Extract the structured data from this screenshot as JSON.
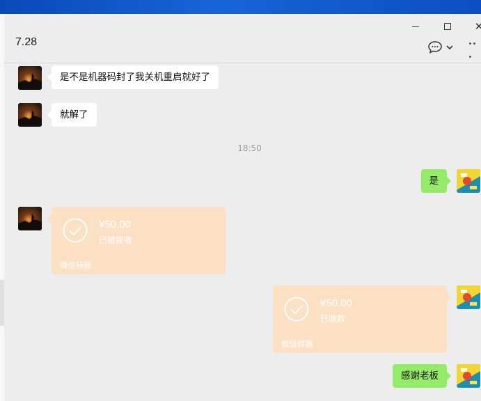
{
  "window": {
    "title": "7.28",
    "minimize_label": "",
    "maximize_label": "",
    "close_label": "✕"
  },
  "messages": [
    {
      "side": "in",
      "type": "text",
      "text": "是不是机器码封了我关机重启就好了"
    },
    {
      "side": "in",
      "type": "text",
      "text": "就解了"
    },
    {
      "type": "time",
      "text": "18:50"
    },
    {
      "side": "out",
      "type": "text",
      "text": "是"
    },
    {
      "side": "in",
      "type": "transfer",
      "amount": "¥50.00",
      "status": "已被接收",
      "footer": "微信转账"
    },
    {
      "side": "out",
      "type": "transfer",
      "amount": "¥50.00",
      "status": "已收款",
      "footer": "微信转账"
    },
    {
      "side": "out",
      "type": "text",
      "text": "感谢老板"
    }
  ],
  "colors": {
    "incoming_bubble": "#ffffff",
    "outgoing_bubble": "#95ec69",
    "transfer_card": "#fce0c4",
    "background": "#ededed",
    "title_bar": "#1764d8"
  },
  "icons": {
    "chat_info": "chat-bubble-icon",
    "more": "more-dots-icon",
    "transfer_received": "check-circle-icon"
  }
}
